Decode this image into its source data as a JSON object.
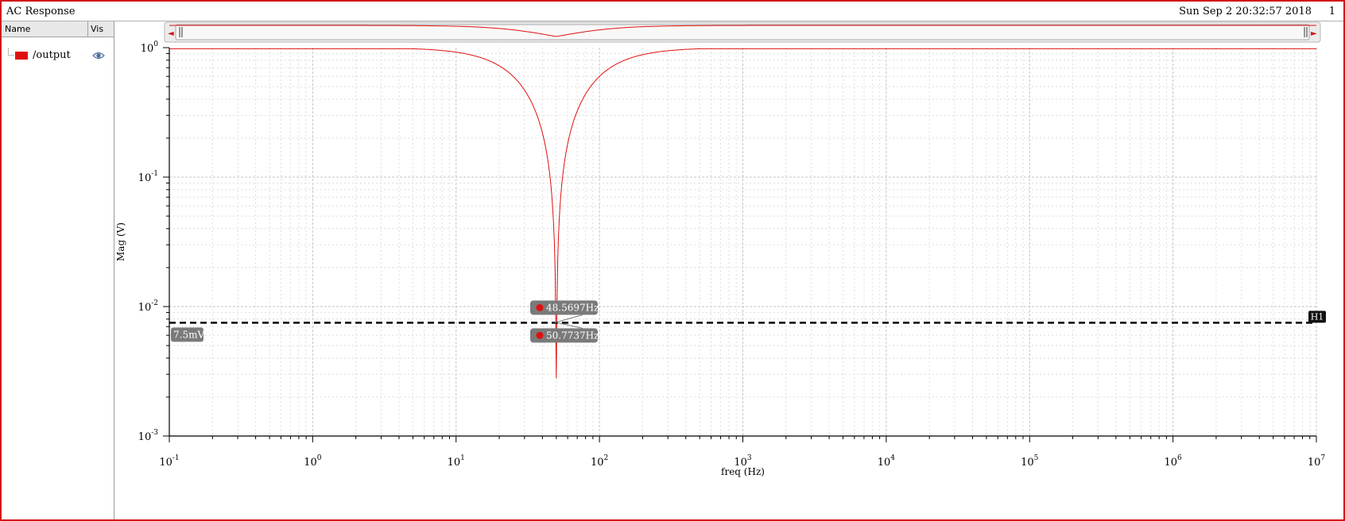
{
  "window": {
    "title": "AC Response",
    "timestamp": "Sun Sep 2 20:32:57 2018",
    "page": "1",
    "frame_color": "#d01818"
  },
  "panel": {
    "header_name": "Name",
    "header_vis": "Vis",
    "traces": [
      {
        "name": "/output",
        "color": "#e01010",
        "icon": "eye-icon"
      }
    ]
  },
  "chart_data": {
    "type": "line",
    "title": "",
    "xlabel": "freq (Hz)",
    "ylabel": "Mag (V)",
    "xscale": "log",
    "yscale": "log",
    "xlim": [
      0.1,
      10000000
    ],
    "ylim": [
      0.001,
      1
    ],
    "grid": true,
    "x_ticks": [
      {
        "base": "10",
        "exp": "-1"
      },
      {
        "base": "10",
        "exp": "0"
      },
      {
        "base": "10",
        "exp": "1"
      },
      {
        "base": "10",
        "exp": "2"
      },
      {
        "base": "10",
        "exp": "3"
      },
      {
        "base": "10",
        "exp": "4"
      },
      {
        "base": "10",
        "exp": "5"
      },
      {
        "base": "10",
        "exp": "6"
      },
      {
        "base": "10",
        "exp": "7"
      }
    ],
    "y_ticks": [
      {
        "base": "10",
        "exp": "0"
      },
      {
        "base": "10",
        "exp": "-1"
      },
      {
        "base": "10",
        "exp": "-2"
      },
      {
        "base": "10",
        "exp": "-3"
      }
    ],
    "series": [
      {
        "name": "/output",
        "color": "#e01010",
        "notch": {
          "f0": 50,
          "q": 0.5,
          "min_depth": 0.0028
        }
      }
    ],
    "hmarker": {
      "label": "H1",
      "value": 0.0075,
      "value_label": "7.5mV"
    },
    "crossings": [
      {
        "x": 48.5697,
        "label": "48.5697Hz"
      },
      {
        "x": 50.7737,
        "label": "50.7737Hz"
      }
    ],
    "zoom_bar": {
      "left_arrow": "◄",
      "right_arrow": "►"
    }
  }
}
